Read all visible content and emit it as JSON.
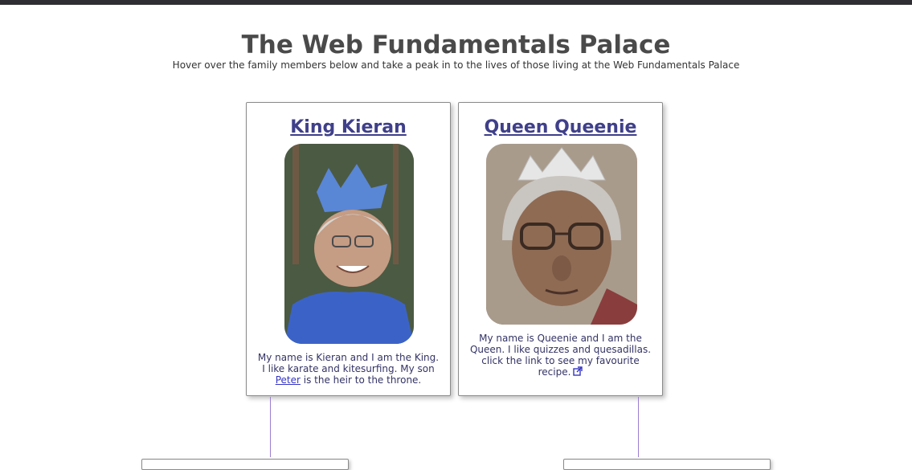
{
  "header": {
    "title": "The Web Fundamentals Palace",
    "subtitle": "Hover over the family members below and take a peak in to the lives of those living at the Web Fundamentals Palace"
  },
  "members": {
    "king": {
      "name": "King Kieran",
      "bio_before_link": "My name is Kieran and I am the King. I like karate and kitesurfing. My son ",
      "bio_link": "Peter",
      "bio_after_link": " is the heir to the throne."
    },
    "queen": {
      "name": "Queen Queenie",
      "bio": "My name is Queenie and I am the Queen. I like quizzes and quesadillas. click the link to see my favourite recipe.",
      "icon": "external-link-icon"
    }
  },
  "colors": {
    "title": "#4a4a4a",
    "name_link": "#3f3f8a",
    "bio_text": "#333366",
    "connector": "#9b7dd1"
  }
}
